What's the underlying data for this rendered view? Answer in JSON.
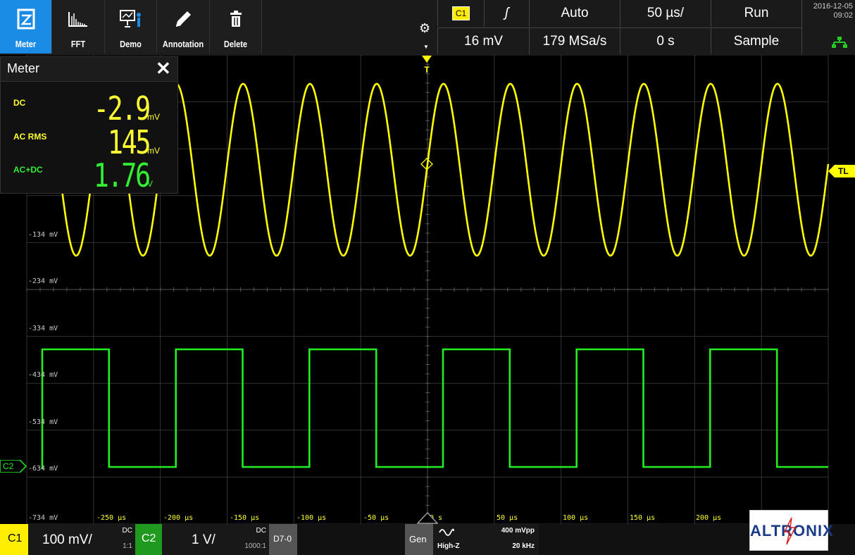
{
  "toolbar": {
    "buttons": [
      {
        "label": "Meter",
        "icon": "meter-icon"
      },
      {
        "label": "FFT",
        "icon": "fft-icon"
      },
      {
        "label": "Demo",
        "icon": "demo-icon"
      },
      {
        "label": "Annotation",
        "icon": "pencil-icon"
      },
      {
        "label": "Delete",
        "icon": "trash-icon"
      }
    ]
  },
  "status": {
    "channel": "C1",
    "slope": "ʃ",
    "trigger_mode": "Auto",
    "timebase": "50 µs/",
    "run_state": "Run",
    "level": "16 mV",
    "sample_rate": "179 MSa/s",
    "position": "0 s",
    "acq_mode": "Sample",
    "date": "2016-12-05",
    "time": "09:02"
  },
  "meter": {
    "title": "Meter",
    "rows": [
      {
        "label": "DC",
        "value": "-2.9",
        "unit": "mV",
        "color": "#ffff33"
      },
      {
        "label": "AC RMS",
        "value": "145",
        "unit": "mV",
        "color": "#ffff33"
      },
      {
        "label": "AC+DC",
        "value": "1.76",
        "unit": "V",
        "color": "#33ee33"
      }
    ]
  },
  "grid": {
    "y_labels": [
      "-134 mV",
      "-234 mV",
      "-334 mV",
      "-434 mV",
      "-534 mV",
      "-634 mV",
      "-734 mV"
    ],
    "x_labels": [
      "-250 µs",
      "-200 µs",
      "-150 µs",
      "-100 µs",
      "-50 µs",
      "0 s",
      "50 µs",
      "100 µs",
      "150 µs",
      "200 µs"
    ]
  },
  "markers": {
    "trigger": "T",
    "trigger_level": "TL",
    "c2": "C2"
  },
  "waveform": {
    "c1_color": "#ffff00",
    "c2_color": "#22ee22",
    "c1_cycles_visible": 12,
    "c2_cycles_visible": 6
  },
  "bottom": {
    "c1": {
      "label": "C1",
      "scale": "100 mV/",
      "coupling": "DC",
      "probe": "1:1"
    },
    "c2": {
      "label": "C2",
      "scale": "1 V/",
      "coupling": "DC",
      "probe": "1000:1"
    },
    "digital": "D7-0",
    "gen": {
      "label": "Gen",
      "impedance": "High-Z",
      "amplitude": "400 mVpp",
      "frequency": "20 kHz"
    },
    "brand": "ALTRONIX"
  }
}
